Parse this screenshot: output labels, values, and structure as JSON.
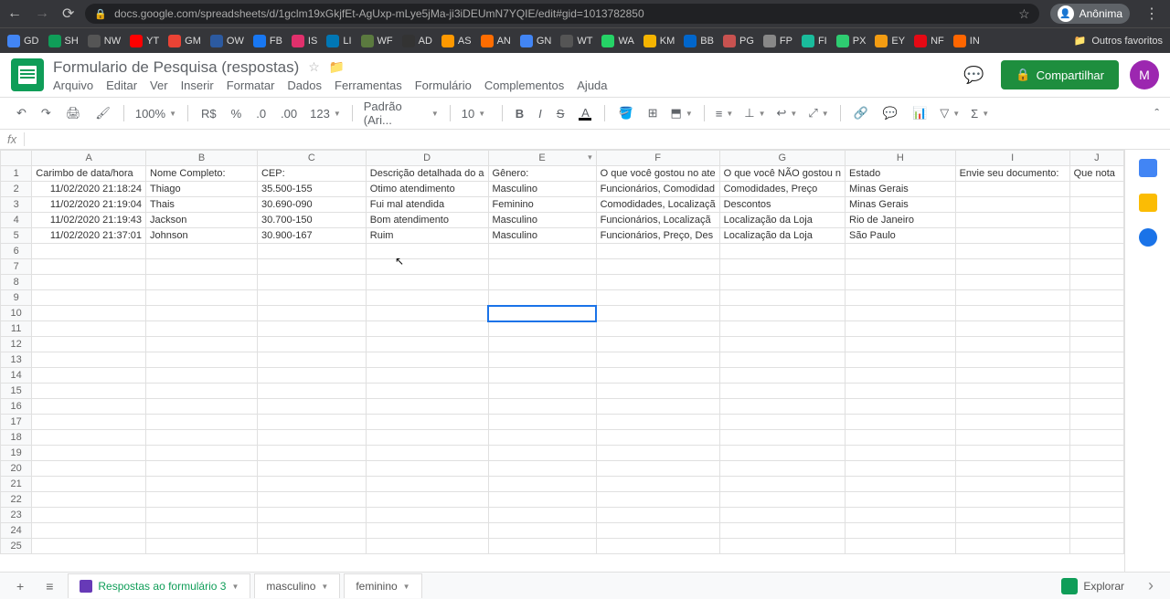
{
  "browser": {
    "url": "docs.google.com/spreadsheets/d/1gclm19xGkjfEt-AgUxp-mLye5jMa-ji3iDEUmN7YQIE/edit#gid=1013782850",
    "profile": "Anônima"
  },
  "bookmarks": [
    {
      "label": "GD",
      "color": "#4285f4"
    },
    {
      "label": "SH",
      "color": "#0f9d58"
    },
    {
      "label": "NW",
      "color": "#555"
    },
    {
      "label": "YT",
      "color": "#ff0000"
    },
    {
      "label": "GM",
      "color": "#ea4335"
    },
    {
      "label": "OW",
      "color": "#2c5aa0"
    },
    {
      "label": "FB",
      "color": "#1877f2"
    },
    {
      "label": "IS",
      "color": "#e1306c"
    },
    {
      "label": "LI",
      "color": "#0077b5"
    },
    {
      "label": "WF",
      "color": "#5b7a3f"
    },
    {
      "label": "AD",
      "color": "#333"
    },
    {
      "label": "AS",
      "color": "#ff9900"
    },
    {
      "label": "AN",
      "color": "#ff6d00"
    },
    {
      "label": "GN",
      "color": "#4285f4"
    },
    {
      "label": "WT",
      "color": "#555"
    },
    {
      "label": "WA",
      "color": "#25d366"
    },
    {
      "label": "KM",
      "color": "#f5b400"
    },
    {
      "label": "BB",
      "color": "#0066cc"
    },
    {
      "label": "PG",
      "color": "#c85250"
    },
    {
      "label": "FP",
      "color": "#888"
    },
    {
      "label": "FI",
      "color": "#1abc9c"
    },
    {
      "label": "PX",
      "color": "#2ecc71"
    },
    {
      "label": "EY",
      "color": "#f39c12"
    },
    {
      "label": "NF",
      "color": "#e50914"
    },
    {
      "label": "IN",
      "color": "#ff6600"
    }
  ],
  "other_bookmarks_label": "Outros favoritos",
  "doc": {
    "title": "Formulario de Pesquisa (respostas)",
    "menu": [
      "Arquivo",
      "Editar",
      "Ver",
      "Inserir",
      "Formatar",
      "Dados",
      "Ferramentas",
      "Formulário",
      "Complementos",
      "Ajuda"
    ],
    "share_label": "Compartilhar",
    "user_initial": "M"
  },
  "toolbar": {
    "zoom": "100%",
    "currency": "R$",
    "percent": "%",
    "dec_less": ".0",
    "dec_more": ".00",
    "num_format": "123",
    "font": "Padrão (Ari...",
    "font_size": "10"
  },
  "formula_bar_label": "fx",
  "columns": [
    "A",
    "B",
    "C",
    "D",
    "E",
    "F",
    "G",
    "H",
    "I",
    "J"
  ],
  "headers": {
    "A": "Carimbo de data/hora",
    "B": "Nome Completo:",
    "C": "CEP:",
    "D": "Descrição detalhada do a",
    "E": "Gênero:",
    "F": "O que você gostou no ate",
    "G": "O que você NÃO gostou n",
    "H": "Estado",
    "I": "Envie seu documento:",
    "J": "Que nota"
  },
  "rows": [
    {
      "A": "11/02/2020 21:18:24",
      "B": "Thiago",
      "C": "35.500-155",
      "D": "Otimo atendimento",
      "E": "Masculino",
      "F": "Funcionários, Comodidad",
      "G": "Comodidades, Preço",
      "H": "Minas Gerais",
      "I": "",
      "J": ""
    },
    {
      "A": "11/02/2020 21:19:04",
      "B": "Thais",
      "C": "30.690-090",
      "D": "Fui mal atendida",
      "E": "Feminino",
      "F": "Comodidades, Localizaçã",
      "G": "Descontos",
      "H": "Minas Gerais",
      "I": "",
      "J": ""
    },
    {
      "A": "11/02/2020 21:19:43",
      "B": "Jackson",
      "C": "30.700-150",
      "D": "Bom atendimento",
      "E": "Masculino",
      "F": "Funcionários, Localizaçã",
      "G": "Localização da Loja",
      "H": "Rio de Janeiro",
      "I": "",
      "J": ""
    },
    {
      "A": "11/02/2020 21:37:01",
      "B": "Johnson",
      "C": "30.900-167",
      "D": "Ruim",
      "E": "Masculino",
      "F": "Funcionários, Preço, Des",
      "G": "Localização da Loja",
      "H": "São Paulo",
      "I": "",
      "J": ""
    }
  ],
  "total_rows": 25,
  "selected_cell": {
    "row": 10,
    "col": "E"
  },
  "sheet_tabs": [
    {
      "label": "Respostas ao formulário 3",
      "active": true,
      "form": true
    },
    {
      "label": "masculino",
      "active": false,
      "form": false
    },
    {
      "label": "feminino",
      "active": false,
      "form": false
    }
  ],
  "explore_label": "Explorar"
}
